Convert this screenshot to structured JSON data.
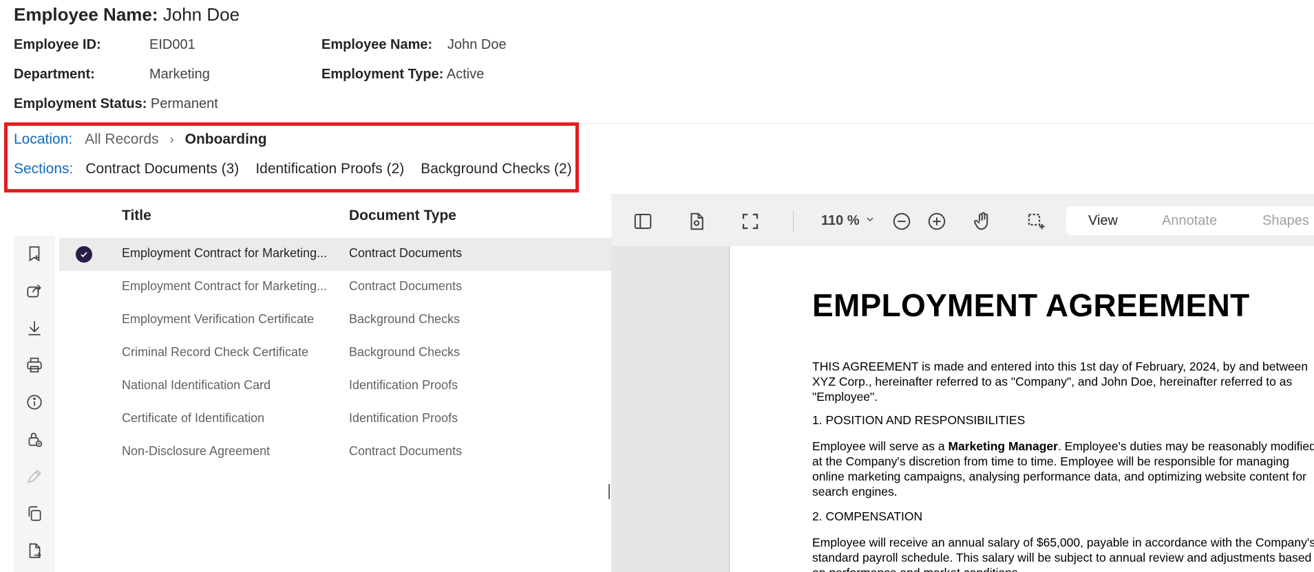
{
  "header": {
    "title_label": "Employee Name:",
    "title_value": "John Doe",
    "fields": [
      {
        "key": "Employee ID:",
        "value": "EID001"
      },
      {
        "key": "Department:",
        "value": "Marketing"
      },
      {
        "key": "Employment Status:",
        "value": "Permanent"
      },
      {
        "key": "Employee Name:",
        "value": "John Doe"
      },
      {
        "key": "Employment Type:",
        "value": "Active"
      }
    ]
  },
  "location": {
    "label": "Location:",
    "crumbs": [
      "All Records",
      "Onboarding"
    ],
    "separator": "›"
  },
  "sections": {
    "label": "Sections:",
    "items": [
      "Contract Documents (3)",
      "Identification Proofs (2)",
      "Background Checks (2)"
    ]
  },
  "table": {
    "columns": [
      "Title",
      "Document Type"
    ],
    "rows": [
      {
        "title": "Employment Contract for Marketing...",
        "type": "Contract Documents",
        "selected": true
      },
      {
        "title": "Employment Contract for Marketing...",
        "type": "Contract Documents",
        "selected": false
      },
      {
        "title": "Employment Verification Certificate",
        "type": "Background Checks",
        "selected": false
      },
      {
        "title": "Criminal Record Check Certificate",
        "type": "Background Checks",
        "selected": false
      },
      {
        "title": "National Identification Card",
        "type": "Identification Proofs",
        "selected": false
      },
      {
        "title": "Certificate of Identification",
        "type": "Identification Proofs",
        "selected": false
      },
      {
        "title": "Non-Disclosure Agreement",
        "type": "Contract Documents",
        "selected": false
      }
    ]
  },
  "left_toolbar_icons": [
    "bookmark-add-icon",
    "share-icon",
    "download-icon",
    "print-icon",
    "info-icon",
    "lock-icon",
    "edit-icon",
    "copy-icon",
    "document-move-icon"
  ],
  "viewer": {
    "zoom": "110 %",
    "modes": [
      "View",
      "Annotate",
      "Shapes"
    ],
    "active_mode": "View",
    "toolbar_icons": [
      "sidebar-icon",
      "document-settings-icon",
      "fullscreen-icon",
      "zoom-out-icon",
      "zoom-in-icon",
      "pan-hand-icon",
      "select-area-icon"
    ]
  },
  "document": {
    "heading": "EMPLOYMENT AGREEMENT",
    "intro": "THIS AGREEMENT is made and entered into this 1st day of February, 2024, by and between XYZ Corp., hereinafter referred to as \"Company\", and John Doe, hereinafter referred to as \"Employee\".",
    "section1_title": "1. POSITION AND RESPONSIBILITIES",
    "section1_pre": "Employee will serve as a ",
    "section1_bold": "Marketing Manager",
    "section1_post": ". Employee's duties may be reasonably modified at the Company's discretion from time to time. Employee will be responsible for managing online marketing campaigns, analysing performance data, and optimizing website content for search engines.",
    "section2_title": "2. COMPENSATION",
    "section2_text": "Employee will receive an annual salary of $65,000, payable in accordance with the Company's standard payroll schedule. This salary will be subject to annual review and adjustments based on performance and market conditions."
  },
  "colors": {
    "accent_blue": "#0f6cbd",
    "highlight_red": "#e01e1e",
    "check_purple": "#2b1d45"
  }
}
